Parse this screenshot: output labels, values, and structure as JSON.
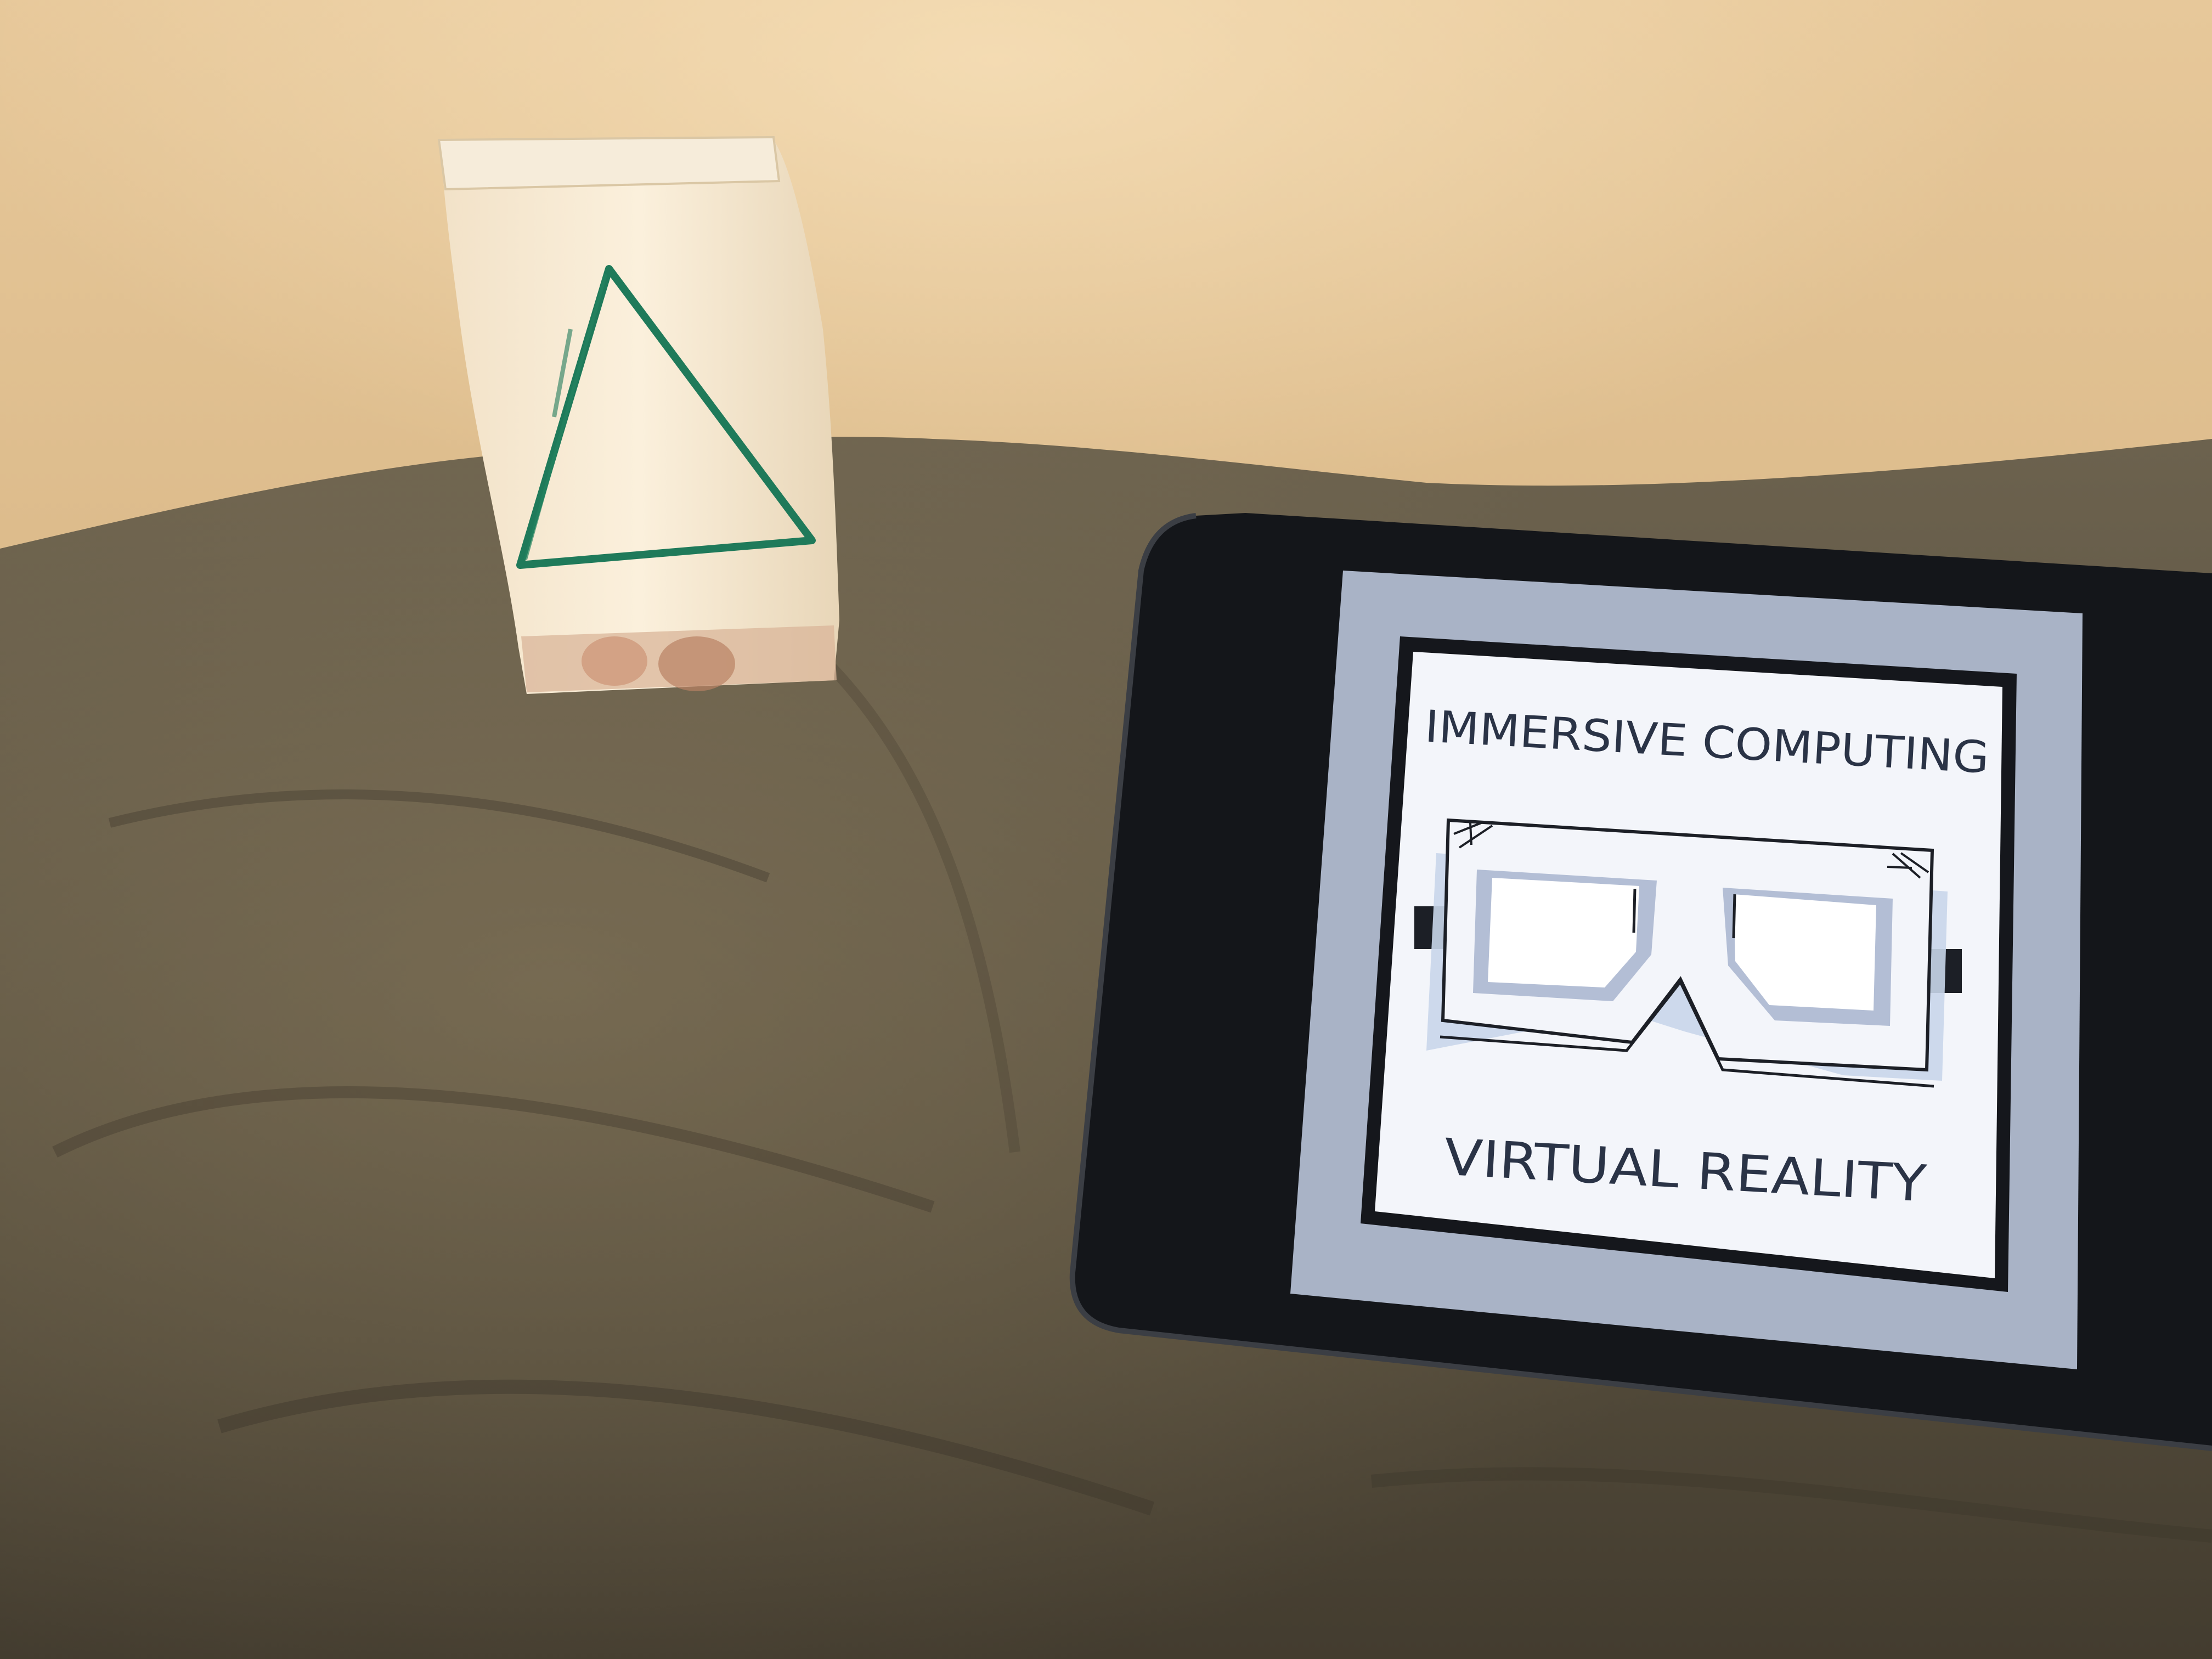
{
  "tablet_screen": {
    "heading": "IMMERSIVE COMPUTING",
    "caption": "VIRTUAL REALITY",
    "icon": "vr-headset-icon"
  },
  "paper_bag": {
    "drawing": "triangle-icon",
    "drawing_color": "#1f7a5a"
  },
  "colors": {
    "bedsheet": "#5e5443",
    "screen_border": "#a9b3c6",
    "screen_background": "#f3f5fa",
    "tablet_bezel": "#14161a"
  }
}
